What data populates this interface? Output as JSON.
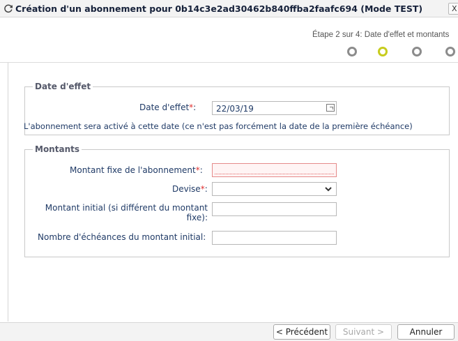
{
  "window": {
    "title": "Création d'un abonnement pour 0b14c3e2ad30462b840ffba2faafc694 (Mode TEST)",
    "close_label": "X",
    "refresh_icon": "refresh-icon"
  },
  "stepper": {
    "text": "Étape 2 sur 4: Date d'effet et montants",
    "current_step": 2,
    "total_steps": 4,
    "active_color": "#c7cc1e",
    "inactive_color": "#8c8c8c"
  },
  "date_group": {
    "legend": "Date d'effet",
    "label": "Date d'effet",
    "required_mark": "*",
    "colon": ":",
    "value": "22/03/19",
    "calendar_icon": "calendar-icon",
    "hint": "L'abonnement sera activé à cette date (ce n'est pas forcément la date de la première échéance)"
  },
  "amounts_group": {
    "legend": "Montants",
    "fixed_amount_label": "Montant fixe de l'abonnement",
    "fixed_amount_value": "",
    "currency_label": "Devise",
    "currency_value": "",
    "currency_icon": "chevron-down-icon",
    "initial_amount_label_line1": "Montant initial (si différent du montant",
    "initial_amount_label_line2": "fixe):",
    "initial_amount_value": "",
    "installments_label": "Nombre d'échéances du montant initial:",
    "installments_value": "",
    "required_mark": "*",
    "colon": ":"
  },
  "footer": {
    "prev_label": "< Précédent",
    "next_label": "Suivant >",
    "cancel_label": "Annuler"
  }
}
